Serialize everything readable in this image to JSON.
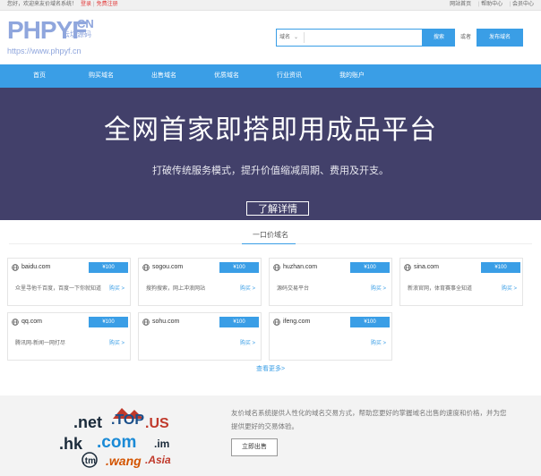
{
  "topbar": {
    "greeting": "您好，欢迎来友价域名系统！",
    "login": "登录",
    "separator": "|",
    "register": "免费注册",
    "links": [
      "网站首页",
      "帮助中心",
      "会员中心"
    ]
  },
  "logo": {
    "main": "PHPYF",
    "cn": "CN",
    "sub": "云坊源码",
    "url": "https://www.phpyf.cn"
  },
  "search": {
    "type_label": "域名",
    "placeholder": "",
    "button": "搜索",
    "or_text": "或者",
    "publish_button": "发布域名"
  },
  "nav": {
    "items": [
      "首页",
      "购买域名",
      "出售域名",
      "优质域名",
      "行业资讯",
      "我的账户"
    ]
  },
  "banner": {
    "title": "全网首家即搭即用成品平台",
    "subtitle": "打破传统服务模式，提升价值缩减周期、费用及开支。",
    "button": "了解详情"
  },
  "section": {
    "title": "一口价域名",
    "more": "查看更多>"
  },
  "domains": [
    {
      "name": "baidu.com",
      "price": "¥100",
      "desc": "众里寻他千百度，百度一下你就知道",
      "buy": "购买 >"
    },
    {
      "name": "sogou.com",
      "price": "¥100",
      "desc": "搜狗搜索，网上冲浪网站",
      "buy": "购买 >"
    },
    {
      "name": "huzhan.com",
      "price": "¥100",
      "desc": "源码交易平台",
      "buy": "购买 >"
    },
    {
      "name": "sina.com",
      "price": "¥100",
      "desc": "新浪官网，体育赛事全知道",
      "buy": "购买 >"
    },
    {
      "name": "qq.com",
      "price": "¥100",
      "desc": "腾讯网-新闻一网打尽",
      "buy": "购买 >"
    },
    {
      "name": "sohu.com",
      "price": "¥100",
      "desc": "",
      "buy": "购买 >"
    },
    {
      "name": "ifeng.com",
      "price": "¥100",
      "desc": "",
      "buy": "购买 >"
    }
  ],
  "promo": {
    "text": "友价域名系统提供人性化的域名交易方式，帮助您更好的掌握域名出售的速度和价格，并为您提供更好的交易体验。",
    "button": "立即出售",
    "tlds": [
      ".net",
      ".TOP",
      ".US",
      ".hk",
      ".com",
      ".im",
      ".tm",
      ".wang",
      ".Asia"
    ]
  },
  "colors": {
    "primary": "#3a9ee6",
    "banner_bg": "#42406a",
    "logo": "#8fa6dd",
    "login_link": "#e23c3c"
  }
}
